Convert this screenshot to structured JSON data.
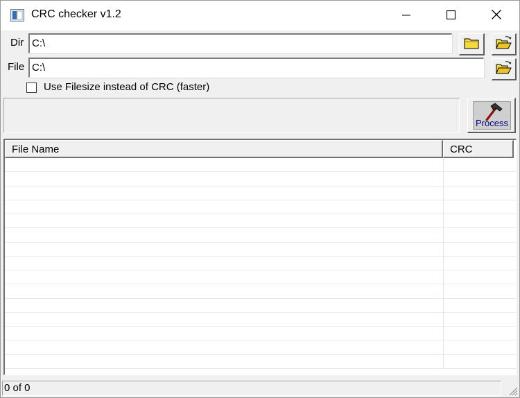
{
  "window": {
    "title": "CRC checker v1.2",
    "icon": "app-icon"
  },
  "titlebar_buttons": [
    "minimize-icon",
    "maximize-icon",
    "close-icon"
  ],
  "dir_row": {
    "label": "Dir",
    "value": "C:\\",
    "browse_icon": "folder-icon",
    "open_icon": "open-folder-icon"
  },
  "file_row": {
    "label": "File",
    "value": "C:\\",
    "open_icon": "open-folder-icon"
  },
  "options": {
    "filesize_label": "Use Filesize instead of CRC (faster)",
    "filesize_checked": false
  },
  "progress": {
    "value": 0
  },
  "process_button": {
    "label": "Process",
    "icon": "hammer-icon"
  },
  "file_list": {
    "columns": [
      "File Name",
      "CRC"
    ],
    "rows": []
  },
  "status": {
    "text": "0 of 0"
  },
  "colors": {
    "face": "#f0f0f0",
    "process_label": "#000080",
    "folder_yellow": "#f5d742"
  }
}
